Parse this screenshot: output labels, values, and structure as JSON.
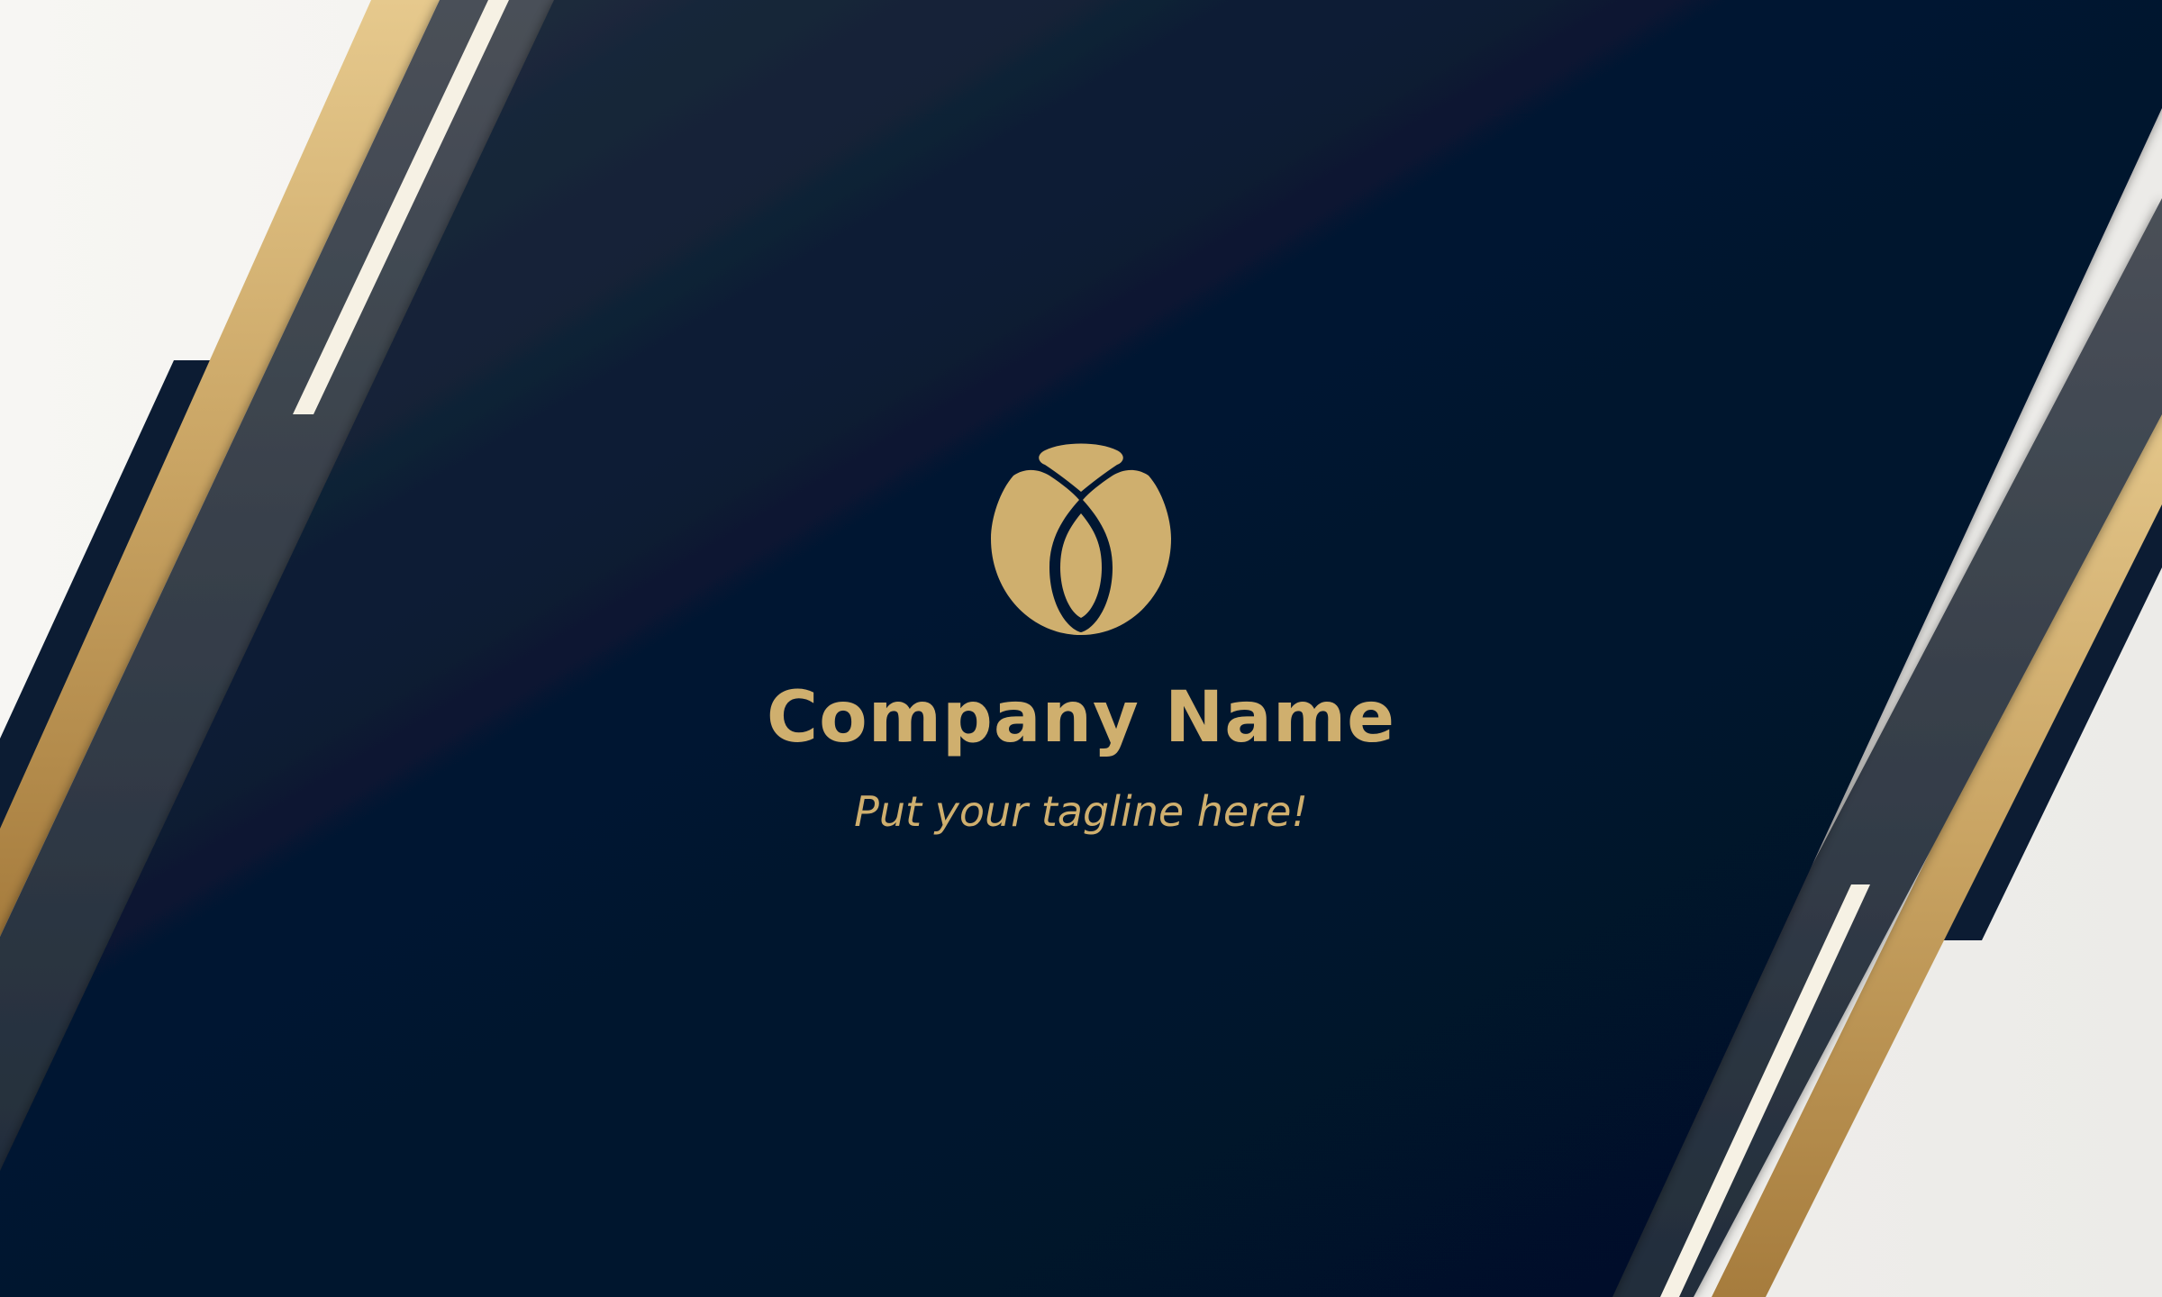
{
  "card": {
    "company_name": "Company Name",
    "tagline": "Put your tagline here!"
  },
  "logo": {
    "icon": "tulip-flower-icon",
    "color": "#cfaf6e"
  },
  "colors": {
    "background_light": "#f2f1ee",
    "navy_dark": "#02122b",
    "navy_mid": "#1e2a3a",
    "slate": "#3d4550",
    "gold": "#c9a463",
    "gold_light": "#f3dfb4",
    "cream_line": "#f7f2e6",
    "text_gold": "#cfaf6e"
  }
}
